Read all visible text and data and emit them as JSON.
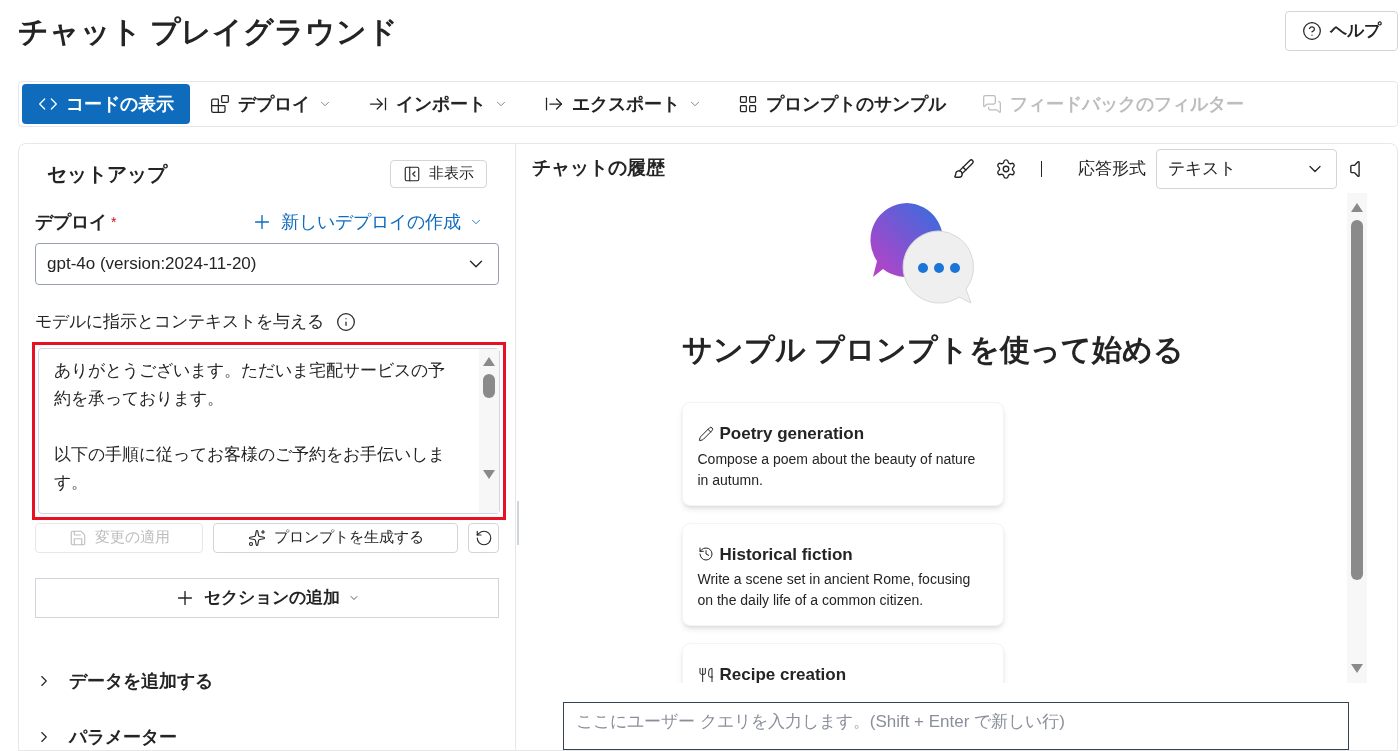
{
  "page": {
    "title": "チャット プレイグラウンド",
    "help_button": "ヘルプ"
  },
  "toolbar": [
    {
      "label": "コードの表示",
      "selected": true,
      "dropdown": false,
      "disabled": false
    },
    {
      "label": "デプロイ",
      "selected": false,
      "dropdown": true,
      "disabled": false
    },
    {
      "label": "インポート",
      "selected": false,
      "dropdown": true,
      "disabled": false
    },
    {
      "label": "エクスポート",
      "selected": false,
      "dropdown": true,
      "disabled": false
    },
    {
      "label": "プロンプトのサンプル",
      "selected": false,
      "dropdown": false,
      "disabled": false
    },
    {
      "label": "フィードバックのフィルター",
      "selected": false,
      "dropdown": false,
      "disabled": true
    }
  ],
  "setup": {
    "title": "セットアップ",
    "hide_button": "非表示",
    "deployment": {
      "label": "デプロイ",
      "required": true,
      "required_mark": "*",
      "create_link": "新しいデプロイの作成",
      "value": "gpt-4o (version:2024-11-20)"
    },
    "instructions": {
      "label": "モデルに指示とコンテキストを与える",
      "paragraphs": [
        "ありがとうございます。ただいま宅配サービスの予約を承っております。",
        "以下の手順に従ってお客様のご予約をお手伝いします。"
      ],
      "highlighted": true
    },
    "buttons": [
      {
        "label": "変更の適用",
        "disabled": true
      },
      {
        "label": "プロンプトを生成する",
        "disabled": false
      }
    ],
    "add_section": "セクションの追加",
    "sections": [
      {
        "label": "データを追加する",
        "expanded": false
      },
      {
        "label": "パラメーター",
        "expanded": false
      }
    ]
  },
  "chat": {
    "title": "チャットの履歴",
    "response_format_label": "応答形式",
    "response_format": "テキスト",
    "heading": "サンプル プロンプトを使って始める",
    "samples": [
      {
        "title": "Poetry generation",
        "description": "Compose a poem about the beauty of nature in autumn."
      },
      {
        "title": "Historical fiction",
        "description": "Write a scene set in ancient Rome, focusing on the daily life of a common citizen."
      },
      {
        "title": "Recipe creation"
      }
    ],
    "input": {
      "placeholder": "ここにユーザー クエリを入力します。(Shift + Enter で新しい行)"
    }
  }
}
